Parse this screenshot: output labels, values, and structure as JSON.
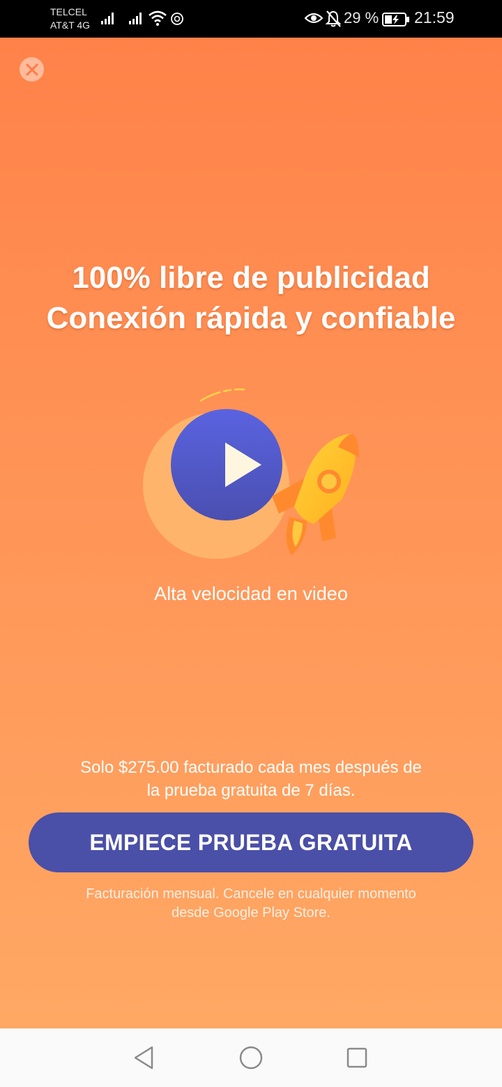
{
  "status_bar": {
    "carrier_primary": "TELCEL",
    "carrier_secondary": "AT&T 4G",
    "battery_percent": "29 %",
    "time": "21:59",
    "icons": [
      "signal-icon",
      "signal-icon",
      "wifi-icon",
      "sync-icon",
      "eye-icon",
      "bell-off-icon",
      "battery-charging-icon"
    ]
  },
  "promo": {
    "headline_line1": "100% libre de publicidad",
    "headline_line2": "Conexión rápida y confiable",
    "feature_caption": "Alta velocidad en video",
    "price_line1": "Solo $275.00 facturado cada mes después de",
    "price_line2": "la prueba gratuita de 7 días.",
    "cta_label": "EMPIECE PRUEBA GRATUITA",
    "fine_print_line1": "Facturación mensual. Cancele en cualquier momento",
    "fine_print_line2": "desde Google Play Store."
  },
  "colors": {
    "background_top": "#ff8249",
    "background_bottom": "#ffa864",
    "cta_button": "#4a4fa8",
    "play_circle": "#5660d8",
    "rocket": "#ffc42a"
  },
  "nav_bar": {
    "icons": [
      "back-icon",
      "home-icon",
      "recent-apps-icon"
    ]
  }
}
